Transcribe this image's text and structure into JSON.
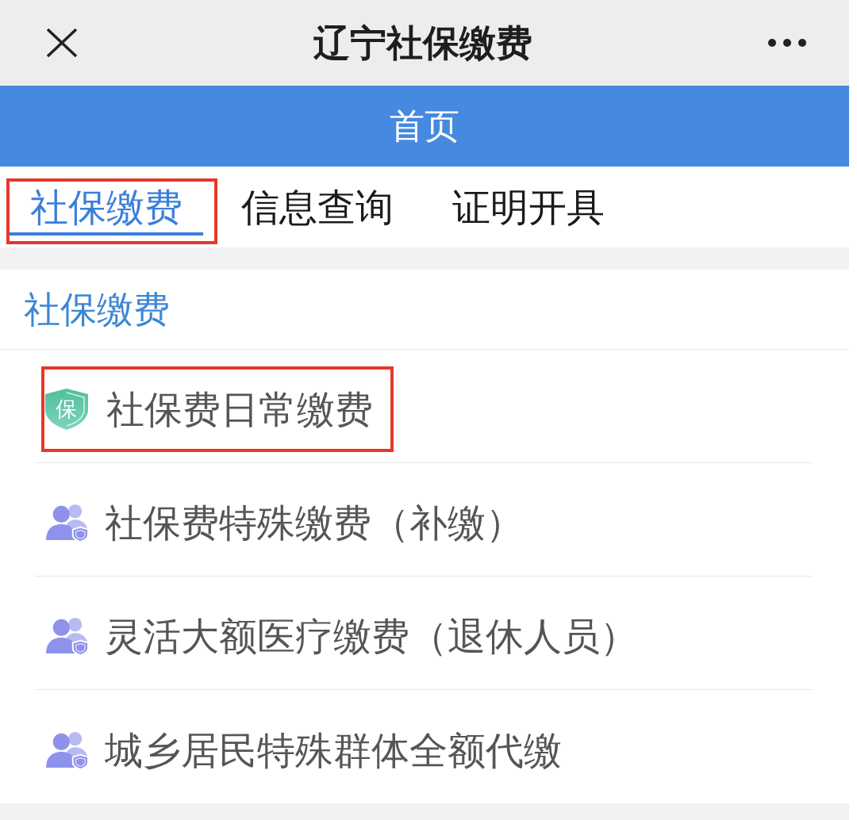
{
  "title_bar": {
    "title": "辽宁社保缴费"
  },
  "banner": {
    "title": "首页"
  },
  "tabs": [
    {
      "label": "社保缴费",
      "selected": true,
      "highlighted": true
    },
    {
      "label": "信息查询",
      "selected": false,
      "highlighted": false
    },
    {
      "label": "证明开具",
      "selected": false,
      "highlighted": false
    }
  ],
  "section": {
    "title": "社保缴费",
    "items": [
      {
        "kind": "regular",
        "badge": "保",
        "label": "社保费日常缴费",
        "highlighted": true
      },
      {
        "kind": "special",
        "label": "社保费特殊缴费（补缴）",
        "highlighted": false
      },
      {
        "kind": "special",
        "label": "灵活大额医疗缴费（退休人员）",
        "highlighted": false
      },
      {
        "kind": "special",
        "label": "城乡居民特殊群体全额代缴",
        "highlighted": false
      }
    ]
  }
}
